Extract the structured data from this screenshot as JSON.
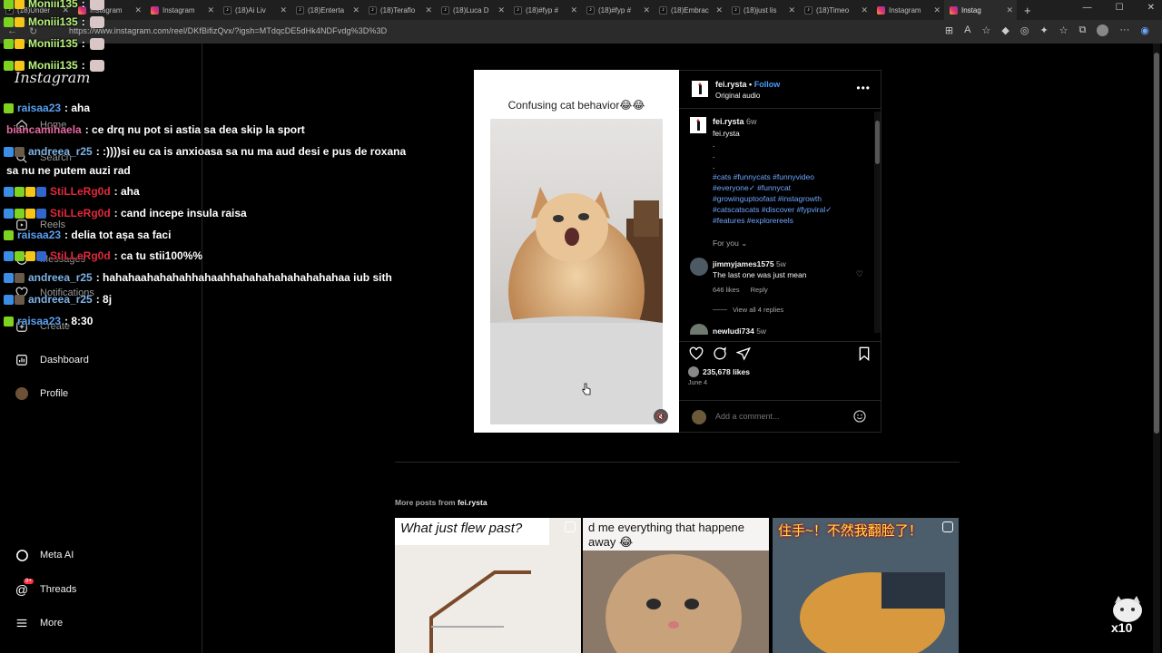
{
  "browser": {
    "tabs": [
      {
        "label": "(18)Under",
        "icon": "tiktok"
      },
      {
        "label": "Instagram",
        "icon": "instagram"
      },
      {
        "label": "Instagram",
        "icon": "instagram"
      },
      {
        "label": "(18)Ai Liv",
        "icon": "tiktok"
      },
      {
        "label": "(18)Enterta",
        "icon": "tiktok"
      },
      {
        "label": "(18)Teraflo",
        "icon": "tiktok"
      },
      {
        "label": "(18)Luca D",
        "icon": "tiktok"
      },
      {
        "label": "(18)#fyp #",
        "icon": "tiktok"
      },
      {
        "label": "(18)#fyp #",
        "icon": "tiktok"
      },
      {
        "label": "(18)Embrac",
        "icon": "tiktok"
      },
      {
        "label": "(18)just lis",
        "icon": "tiktok"
      },
      {
        "label": "(18)Timeo",
        "icon": "tiktok"
      },
      {
        "label": "Instagram",
        "icon": "instagram"
      },
      {
        "label": "Instag",
        "icon": "instagram"
      }
    ],
    "url": "https://www.instagram.com/reel/DKfBifizQvx/?igsh=MTdqcDE5dHk4NDFvdg%3D%3D"
  },
  "sidebar": {
    "logo": "Instagram",
    "items": [
      {
        "label": "Home",
        "icon": "home-icon"
      },
      {
        "label": "Search",
        "icon": "search-icon"
      },
      {
        "label": "Reels",
        "icon": "reels-icon"
      },
      {
        "label": "Messages",
        "icon": "messages-icon"
      },
      {
        "label": "Notifications",
        "icon": "heart-icon"
      },
      {
        "label": "Create",
        "icon": "plus-icon"
      },
      {
        "label": "Dashboard",
        "icon": "dashboard-icon"
      },
      {
        "label": "Profile",
        "icon": "avatar"
      },
      {
        "label": "Meta AI",
        "icon": "meta-ai-icon"
      },
      {
        "label": "Threads",
        "icon": "threads-icon",
        "badge": "9+"
      },
      {
        "label": "More",
        "icon": "menu-icon"
      }
    ]
  },
  "post": {
    "media_caption": "Confusing cat behavior😂😂",
    "author": "fei.rysta",
    "follow_label": "Follow",
    "separator": "•",
    "audio": "Original audio",
    "caption_user": "fei.rysta",
    "caption_time": "6w",
    "caption_text": "fei.rysta",
    "caption_dots": [
      ".",
      ".",
      "."
    ],
    "hashtags": [
      "#cats #funnycats #funnyvideo",
      "#everyone✓ #funnycat",
      "#growinguptoofast #instagrowth",
      "#catscatscats #discover #fypviral✓",
      "#features #explorereels"
    ],
    "for_you": "For you",
    "comments": [
      {
        "user": "jimmyjames1575",
        "time": "5w",
        "text": "The last one was just mean",
        "likes": "646 likes",
        "reply": "Reply",
        "view_replies": "View all 4 replies"
      },
      {
        "user": "newludi734",
        "time": "5w"
      }
    ],
    "likes": "235,678 likes",
    "date": "June 4",
    "comment_placeholder": "Add a comment..."
  },
  "more_posts": {
    "label": "More posts from",
    "user": "fei.rysta",
    "thumbs": [
      {
        "text": "What just flew past?"
      },
      {
        "text": "d me everything that happene away 😂"
      },
      {
        "text": "住手~！不然我翻脸了！"
      }
    ]
  },
  "chat": [
    {
      "user": "Moniii135",
      "text": ":",
      "color": "#b8f27a"
    },
    {
      "user": "Moniii135",
      "text": ":",
      "color": "#b8f27a"
    },
    {
      "user": "Moniii135",
      "text": ":",
      "color": "#b8f27a"
    },
    {
      "user": "Moniii135",
      "text": ":",
      "color": "#b8f27a"
    },
    {
      "user": "raisaa23",
      "text": ": aha",
      "color": "#5aa0f0"
    },
    {
      "user": "biancamihaela",
      "text": ": ce drq nu pot si astia sa dea skip la sport",
      "color": "#e56aa0"
    },
    {
      "user": "andreea_r25",
      "text": ": :))))si eu ca is anxioasa sa nu ma aud desi e pus de roxana",
      "color": "#7fb3e6"
    },
    {
      "user": "",
      "text": "sa nu ne putem auzi rad",
      "color": "#ffffff"
    },
    {
      "user": "StiLLeRg0d",
      "text": ": aha",
      "color": "#e02a3a"
    },
    {
      "user": "StiLLeRg0d",
      "text": ": cand incepe insula raisa",
      "color": "#e02a3a"
    },
    {
      "user": "raisaa23",
      "text": ": delia tot așa sa faci",
      "color": "#5aa0f0"
    },
    {
      "user": "StiLLeRg0d",
      "text": ": ca tu stii100%%",
      "color": "#e02a3a"
    },
    {
      "user": "andreea_r25",
      "text": ": hahahaahahahahhahaahhahahahahahahahahaa iub sith",
      "color": "#7fb3e6"
    },
    {
      "user": "andreea_r25",
      "text": ": 8j",
      "color": "#7fb3e6"
    },
    {
      "user": "raisaa23",
      "text": ": 8:30",
      "color": "#5aa0f0"
    }
  ],
  "emote_counter": "x10"
}
